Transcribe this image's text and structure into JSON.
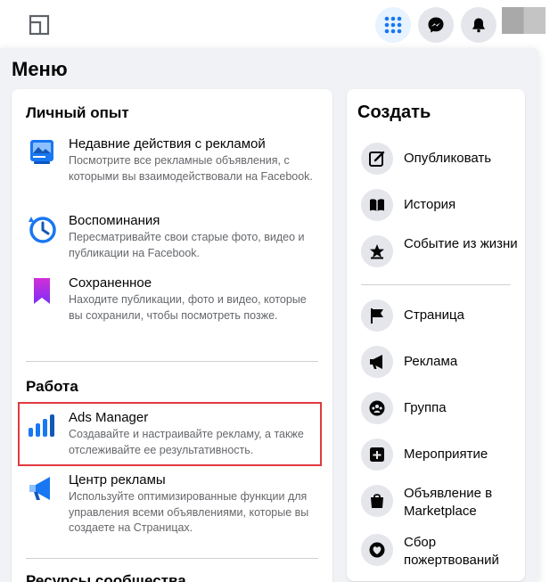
{
  "menu": {
    "title": "Меню"
  },
  "personal": {
    "title": "Личный опыт",
    "items": [
      {
        "title": "Недавние действия с рекламой",
        "desc": "Посмотрите все рекламные объявления, с которыми вы взаимодействовали на Facebook.",
        "icon": "recent-ads-icon"
      },
      {
        "title": "Воспоминания",
        "desc": "Пересматривайте свои старые фото, видео и публикации на Facebook.",
        "icon": "memories-clock-icon"
      },
      {
        "title": "Сохраненное",
        "desc": "Находите публикации, фото и видео, которые вы сохранили, чтобы посмотреть позже.",
        "icon": "saved-bookmark-icon"
      }
    ]
  },
  "work": {
    "title": "Работа",
    "items": [
      {
        "title": "Ads Manager",
        "desc": "Создавайте и настраивайте рекламу, а также отслеживайте ее результативность.",
        "icon": "ads-manager-bars-icon"
      },
      {
        "title": "Центр рекламы",
        "desc": "Используйте оптимизированные функции для управления всеми объявлениями, которые вы создаете на Страницах.",
        "icon": "megaphone-icon"
      }
    ]
  },
  "community": {
    "title": "Ресурсы сообщества"
  },
  "create": {
    "title": "Создать",
    "items": [
      {
        "label": "Опубликовать",
        "icon": "compose-icon"
      },
      {
        "label": "История",
        "icon": "book-icon"
      },
      {
        "label": "Событие из жизни",
        "icon": "star-icon"
      },
      {
        "label": "Страница",
        "icon": "flag-icon"
      },
      {
        "label": "Реклама",
        "icon": "megaphone-icon"
      },
      {
        "label": "Группа",
        "icon": "group-icon"
      },
      {
        "label": "Мероприятие",
        "icon": "event-plus-icon"
      },
      {
        "label": "Объявление в Marketplace",
        "icon": "shopping-bag-icon"
      },
      {
        "label": "Сбор пожертвований",
        "icon": "heart-icon"
      }
    ]
  },
  "colors": {
    "accent": "#1877f2",
    "highlight": "#e0393e",
    "panel_bg": "#f0f2f5"
  }
}
